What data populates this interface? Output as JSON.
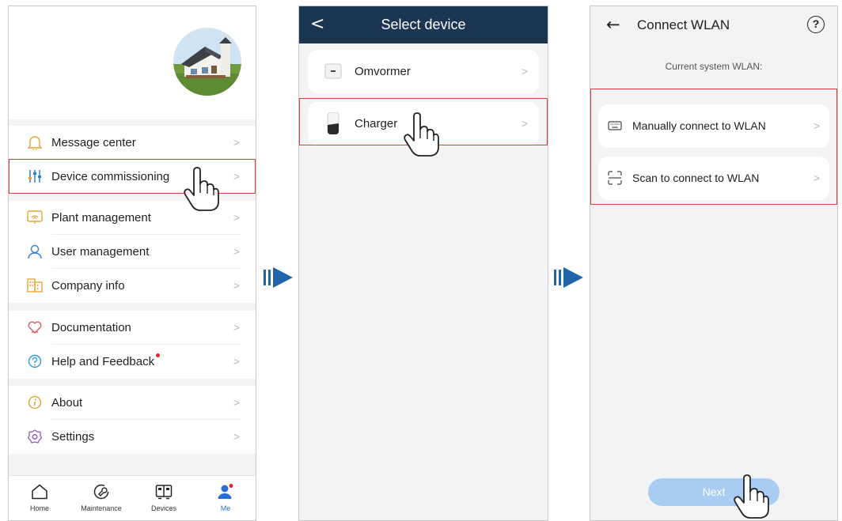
{
  "screen1": {
    "menu_groups": [
      [
        {
          "label": "Message center",
          "icon": "bell-icon",
          "dot": false
        },
        {
          "label": "Device commissioning",
          "icon": "sliders-icon",
          "dot": false
        }
      ],
      [
        {
          "label": "Plant management",
          "icon": "plant-icon",
          "dot": false
        },
        {
          "label": "User management",
          "icon": "user-icon",
          "dot": false
        },
        {
          "label": "Company info",
          "icon": "building-icon",
          "dot": false
        }
      ],
      [
        {
          "label": "Documentation",
          "icon": "documentation-icon",
          "dot": false
        },
        {
          "label": "Help and Feedback",
          "icon": "help-icon",
          "dot": true
        }
      ],
      [
        {
          "label": "About",
          "icon": "info-icon",
          "dot": false
        },
        {
          "label": "Settings",
          "icon": "settings-icon",
          "dot": false
        }
      ]
    ],
    "chevron": ">",
    "bottom_nav": {
      "home": "Home",
      "maintenance": "Maintenance",
      "devices": "Devices",
      "me": "Me",
      "active": "Me"
    },
    "highlighted_item": "Device commissioning"
  },
  "screen2": {
    "back_glyph": "<",
    "title": "Select device",
    "devices": [
      {
        "label": "Omvormer"
      },
      {
        "label": "Charger"
      }
    ],
    "chevron": ">",
    "highlighted_item": "Charger"
  },
  "screen3": {
    "back_glyph": "←",
    "title": "Connect WLAN",
    "help_glyph": "?",
    "current_label": "Current system WLAN:",
    "options": [
      {
        "label": "Manually connect to WLAN",
        "icon": "keyboard-icon"
      },
      {
        "label": "Scan to connect to WLAN",
        "icon": "scan-icon"
      }
    ],
    "chevron": ">",
    "next_button": "Next"
  },
  "colors": {
    "highlight": "#e03c3c",
    "navbar": "#1c3552",
    "flow_arrow": "#1f65a8",
    "active_blue": "#2870d6",
    "next_disabled": "#a9cdf2"
  }
}
